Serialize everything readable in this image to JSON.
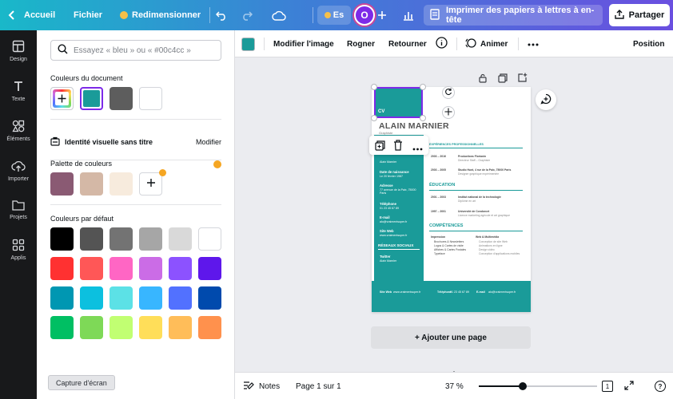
{
  "topbar": {
    "home_label": "Accueil",
    "file_label": "Fichier",
    "resize_label": "Redimensionner",
    "lang_label": "Es",
    "avatar_initial": "O",
    "print_label": "Imprimer des papiers à lettres à en-tête",
    "share_label": "Partager"
  },
  "rail": {
    "items": [
      {
        "label": "Design",
        "icon": "layout-icon"
      },
      {
        "label": "Texte",
        "icon": "text-icon"
      },
      {
        "label": "Éléments",
        "icon": "shapes-icon"
      },
      {
        "label": "Importer",
        "icon": "upload-cloud-icon"
      },
      {
        "label": "Projets",
        "icon": "folder-icon"
      },
      {
        "label": "Applis",
        "icon": "apps-icon"
      }
    ]
  },
  "panel": {
    "search_placeholder": "Essayez « bleu » ou « #00c4cc »",
    "doc_colors_title": "Couleurs du document",
    "doc_colors": [
      "#1a9b99",
      "#5d5d5d",
      "#ffffff"
    ],
    "brand_title": "Identité visuelle sans titre",
    "brand_action": "Modifier",
    "palette_title": "Palette de couleurs",
    "palette": [
      "#8a5a73",
      "#d4b8a6",
      "#f7ebdd"
    ],
    "default_title": "Couleurs par défaut",
    "defaults": [
      [
        "#000000",
        "#545454",
        "#737373",
        "#a6a6a6",
        "#d9d9d9",
        "#ffffff"
      ],
      [
        "#ff3131",
        "#ff5757",
        "#ff66c4",
        "#cb6ce6",
        "#8c52ff",
        "#5e17eb"
      ],
      [
        "#0097b2",
        "#0cc0df",
        "#5ce1e6",
        "#38b6ff",
        "#5271ff",
        "#004aad"
      ],
      [
        "#00bf63",
        "#7ed957",
        "#c1ff72",
        "#ffde59",
        "#ffbd59",
        "#ff914d"
      ]
    ]
  },
  "context_toolbar": {
    "selected_color": "#1a9b99",
    "edit_image": "Modifier l'image",
    "crop": "Rogner",
    "flip": "Retourner",
    "animate": "Animer",
    "position": "Position"
  },
  "cv": {
    "cv_label": "CV",
    "name": "ALAIN MARNIER",
    "subtitle": "Graphiste",
    "exp_title": "EXPÉRIENCES PROFESSIONNELLES",
    "edu_title": "ÉDUCATION",
    "skills_title": "COMPÉTENCES",
    "social_title": "RÉSEAUX SOCIAUX",
    "left_labels": [
      "Date de naissance",
      "Adresse",
      "Téléphone",
      "E-mail",
      "Site Web",
      "Twitter"
    ],
    "left_values": [
      "Le 20 février 1987",
      "77 avenue de la Paix, 75000 Paris",
      "01 23 45 67 89",
      "alo@vraimentsuper.fr",
      "www.vraimentsuper.fr",
      "Alain Marnier"
    ],
    "exp": [
      {
        "years": "2003 – 2016",
        "title": "Productions Florianin",
        "desc": "Directeur Staff – Graphiste"
      },
      {
        "years": "2003 – 2005",
        "title": "Studio Hunt, 4 rue de la Paix, 75000 Paris",
        "desc": "Designer graphique expérimentée"
      }
    ],
    "edu": [
      {
        "years": "2001 – 2003",
        "title": "Institut national de la technologie",
        "desc": "Diplôme en art"
      },
      {
        "years": "1997 – 2001",
        "title": "Université de Condorcet",
        "desc": "Licence marketing agricole et art graphique"
      }
    ],
    "skills_left_title": "Impression",
    "skills_left": [
      "Brochures & Newsletters",
      "Logos & Cartes de visite",
      "Affiches & Cartes Postales",
      "Typeface"
    ],
    "skills_right_title": "Web & Multimédia",
    "skills_right": [
      "Conception de site Web",
      "Animations en ligne",
      "Design vidéo",
      "Conception d'applications mobiles"
    ],
    "footer_web_label": "Site Web",
    "footer_web": "www.vraimentsuper.fr",
    "footer_phone_label": "Téléphone",
    "footer_phone": "01 23 45 67 89",
    "footer_email_label": "E-mail",
    "footer_email": "alo@vraimentsuper.fr"
  },
  "canvas": {
    "add_page": "+ Ajouter une page"
  },
  "bottom": {
    "notes": "Notes",
    "page_info": "Page 1 sur 1",
    "zoom": "37 %",
    "zoom_fraction": 0.37,
    "page_count": "1",
    "help": "?"
  },
  "tooltip": {
    "text": "Capture d'écran"
  }
}
